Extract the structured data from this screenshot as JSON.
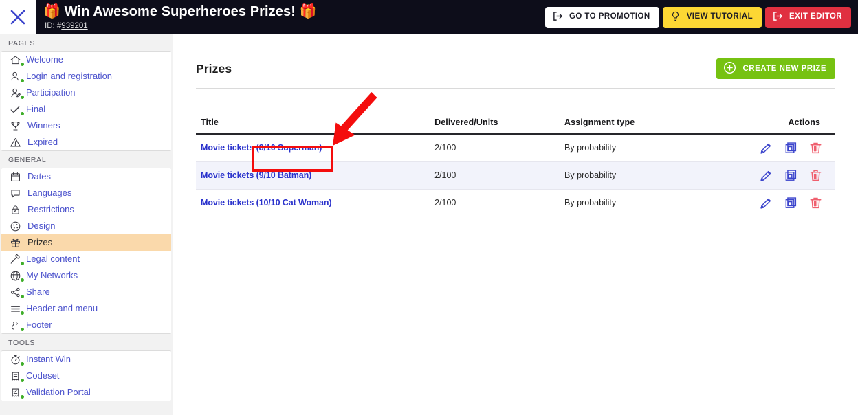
{
  "topbar": {
    "close_icon": "close-x-icon",
    "promo_title": "🎁 Win Awesome Superheroes Prizes! 🎁",
    "id_prefix": "ID: #",
    "id_number": "939201",
    "buttons": [
      {
        "name": "go-to-promotion",
        "label": "GO TO PROMOTION",
        "icon": "exit-arrow-icon",
        "bg": "#ffffff",
        "fg": "#1c1c26"
      },
      {
        "name": "view-tutorial",
        "label": "VIEW TUTORIAL",
        "icon": "lightbulb-icon",
        "bg": "#fcd734",
        "fg": "#1c1c26"
      },
      {
        "name": "exit-editor",
        "label": "EXIT EDITOR",
        "icon": "exit-arrow-icon",
        "bg": "#e03040",
        "fg": "#ffffff"
      }
    ]
  },
  "sidebar": {
    "sections": [
      {
        "label": "PAGES",
        "items": [
          {
            "label": "Welcome",
            "icon": "home-icon",
            "dot": true,
            "active": false
          },
          {
            "label": "Login and registration",
            "icon": "user-check-icon",
            "dot": true,
            "active": false
          },
          {
            "label": "Participation",
            "icon": "user-edit-icon",
            "dot": true,
            "active": false
          },
          {
            "label": "Final",
            "icon": "check-icon",
            "dot": true,
            "active": false
          },
          {
            "label": "Winners",
            "icon": "trophy-icon",
            "dot": false,
            "active": false
          },
          {
            "label": "Expired",
            "icon": "warning-icon",
            "dot": false,
            "active": false
          }
        ]
      },
      {
        "label": "GENERAL",
        "items": [
          {
            "label": "Dates",
            "icon": "calendar-icon",
            "dot": false,
            "active": false
          },
          {
            "label": "Languages",
            "icon": "speech-icon",
            "dot": false,
            "active": false
          },
          {
            "label": "Restrictions",
            "icon": "lock-icon",
            "dot": false,
            "active": false
          },
          {
            "label": "Design",
            "icon": "palette-icon",
            "dot": false,
            "active": false
          },
          {
            "label": "Prizes",
            "icon": "gift-icon",
            "dot": false,
            "active": true
          },
          {
            "label": "Legal content",
            "icon": "gavel-icon",
            "dot": true,
            "active": false
          },
          {
            "label": "My Networks",
            "icon": "network-icon",
            "dot": true,
            "active": false
          },
          {
            "label": "Share",
            "icon": "share-icon",
            "dot": true,
            "active": false
          },
          {
            "label": "Header and menu",
            "icon": "menu-lines-icon",
            "dot": true,
            "active": false
          },
          {
            "label": "Footer",
            "icon": "footer-icon",
            "dot": true,
            "active": false
          }
        ]
      },
      {
        "label": "TOOLS",
        "items": [
          {
            "label": "Instant Win",
            "icon": "stopwatch-icon",
            "dot": true,
            "active": false
          },
          {
            "label": "Codeset",
            "icon": "ticket-icon",
            "dot": true,
            "active": false
          },
          {
            "label": "Validation Portal",
            "icon": "receipt-icon",
            "dot": true,
            "active": false
          }
        ]
      }
    ]
  },
  "main": {
    "page_title": "Prizes",
    "create_button": {
      "label": "CREATE NEW PRIZE",
      "icon": "plus-circle-icon",
      "color": "#76c211"
    },
    "table": {
      "columns": [
        "Title",
        "Delivered/Units",
        "Assignment type",
        "Actions"
      ],
      "rows": [
        {
          "title": "Movie tickets (8/10 Superman)",
          "delivered": "2/100",
          "assignment": "By probability"
        },
        {
          "title": "Movie tickets (9/10 Batman)",
          "delivered": "2/100",
          "assignment": "By probability"
        },
        {
          "title": "Movie tickets (10/10 Cat Woman)",
          "delivered": "2/100",
          "assignment": "By probability"
        }
      ],
      "row_actions": [
        {
          "name": "edit-prize-icon",
          "icon": "pencil-icon",
          "color": "#3b44cc"
        },
        {
          "name": "duplicate-prize-icon",
          "icon": "copy-icon",
          "color": "#3b44cc"
        },
        {
          "name": "delete-prize-icon",
          "icon": "trash-icon",
          "color": "#ef5f6e"
        }
      ]
    }
  },
  "annotation": {
    "highlight_color": "#f40d0d",
    "arrow_color": "#f40d0d",
    "target_text": "(8/10 Superman)"
  }
}
